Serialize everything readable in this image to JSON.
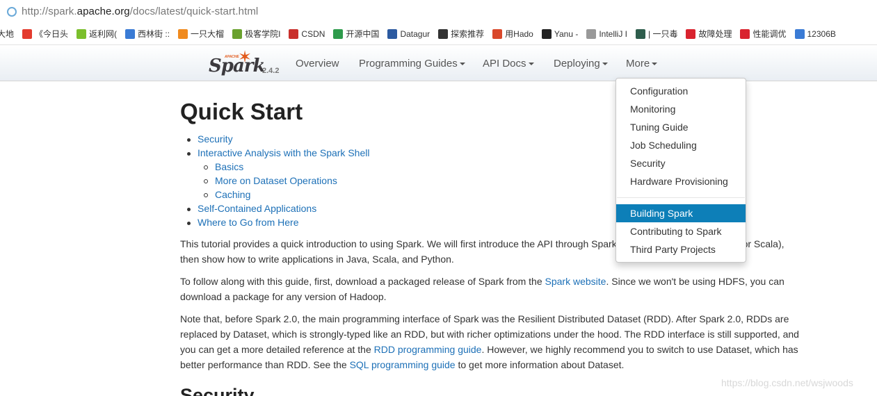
{
  "browser": {
    "url_prefix": "http://spark.",
    "url_domain": "apache.org",
    "url_path": "/docs/latest/quick-start.html"
  },
  "bookmarks": [
    {
      "label": "大地",
      "icon": "none",
      "color": "#ffffff"
    },
    {
      "label": "《今日头",
      "icon": "toutiao-icon",
      "color": "#e33b2e"
    },
    {
      "label": "返利网(",
      "icon": "fanli-icon",
      "color": "#7bbf2c"
    },
    {
      "label": "西林街 ::",
      "icon": "circle-icon",
      "color": "#3a7bd5"
    },
    {
      "label": "一只大榴",
      "icon": "plus-icon",
      "color": "#f08a1e"
    },
    {
      "label": "极客学院I",
      "icon": "jike-icon",
      "color": "#6aa12e"
    },
    {
      "label": "CSDN",
      "icon": "csdn-icon",
      "color": "#c9302c"
    },
    {
      "label": "开源中国",
      "icon": "oschina-icon",
      "color": "#2e9b4c"
    },
    {
      "label": "Datagur",
      "icon": "chart-icon",
      "color": "#2c5aa0"
    },
    {
      "label": "探索推荐",
      "icon": "network-icon",
      "color": "#333333"
    },
    {
      "label": "用Hado",
      "icon": "hadoop-icon",
      "color": "#d9482b"
    },
    {
      "label": "Yanu -",
      "icon": "c-icon",
      "color": "#222222"
    },
    {
      "label": "IntelliJ I",
      "icon": "page-icon",
      "color": "#999999"
    },
    {
      "label": "| 一只毒",
      "icon": "dot-icon",
      "color": "#2e5d4c"
    },
    {
      "label": "故障处理",
      "icon": "huawei-icon",
      "color": "#d9232e"
    },
    {
      "label": "性能调优",
      "icon": "huawei-icon",
      "color": "#d9232e"
    },
    {
      "label": "12306B",
      "icon": "page-icon",
      "color": "#3a7bd5"
    }
  ],
  "navbar": {
    "logo_apache": "APACHE",
    "logo_spark": "Spark",
    "version": "2.4.2",
    "items": [
      {
        "label": "Overview",
        "has_caret": false
      },
      {
        "label": "Programming Guides",
        "has_caret": true
      },
      {
        "label": "API Docs",
        "has_caret": true
      },
      {
        "label": "Deploying",
        "has_caret": true
      },
      {
        "label": "More",
        "has_caret": true
      }
    ]
  },
  "dropdown": {
    "group1": [
      "Configuration",
      "Monitoring",
      "Tuning Guide",
      "Job Scheduling",
      "Security",
      "Hardware Provisioning"
    ],
    "group2": [
      "Building Spark",
      "Contributing to Spark",
      "Third Party Projects"
    ],
    "active": "Building Spark"
  },
  "page": {
    "title": "Quick Start",
    "toc": [
      {
        "label": "Security",
        "level": 1
      },
      {
        "label": "Interactive Analysis with the Spark Shell",
        "level": 1
      },
      {
        "label": "Basics",
        "level": 2
      },
      {
        "label": "More on Dataset Operations",
        "level": 2
      },
      {
        "label": "Caching",
        "level": 2
      },
      {
        "label": "Self-Contained Applications",
        "level": 1
      },
      {
        "label": "Where to Go from Here",
        "level": 1
      }
    ],
    "p1_line1": "This tutorial provides a quick introduction to using Spark. We will first introduce the API through Spark's interactive shell (in Python or Scala),",
    "p1_line2": "then show how to write applications in Java, Scala, and Python.",
    "p2_a": "To follow along with this guide, first, download a packaged release of Spark from the ",
    "p2_link": "Spark website",
    "p2_b": ". Since we won't be using HDFS, you can",
    "p2_line2": "download a package for any version of Hadoop.",
    "p3_line1": "Note that, before Spark 2.0, the main programming interface of Spark was the Resilient Distributed Dataset (RDD). After Spark 2.0, RDDs are",
    "p3_line2": "replaced by Dataset, which is strongly-typed like an RDD, but with richer optimizations under the hood. The RDD interface is still supported, and",
    "p3_line3a": "you can get a more detailed reference at the ",
    "p3_link1": "RDD programming guide",
    "p3_line3b": ". However, we highly recommend you to switch to use Dataset, which has",
    "p3_line4a": "better performance than RDD. See the ",
    "p3_link2": "SQL programming guide",
    "p3_line4b": " to get more information about Dataset.",
    "section_heading": "Security"
  },
  "watermark": "https://blog.csdn.net/wsjwoods"
}
